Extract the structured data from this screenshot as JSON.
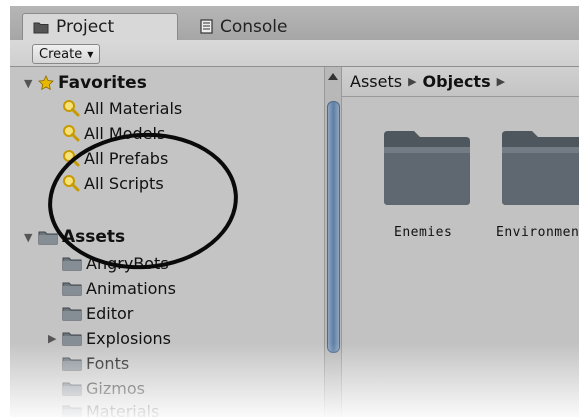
{
  "tabs": [
    {
      "label": "Project",
      "icon": "folder-tab-icon",
      "active": true
    },
    {
      "label": "Console",
      "icon": "console-tab-icon",
      "active": false
    }
  ],
  "toolbar": {
    "create_label": "Create"
  },
  "favorites": {
    "label": "Favorites",
    "items": [
      "All Materials",
      "All Models",
      "All Prefabs",
      "All Scripts"
    ]
  },
  "assets": {
    "label": "Assets",
    "items": [
      "AngryBots",
      "Animations",
      "Editor",
      "Explosions",
      "Fonts",
      "Gizmos",
      "Materials"
    ]
  },
  "breadcrumb": {
    "root": "Assets",
    "current": "Objects"
  },
  "grid": {
    "items": [
      "Enemies",
      "Environment"
    ]
  },
  "colors": {
    "folder": "#5f6870",
    "scroll_thumb": "#5f7ea3",
    "search_icon": "#e8b800"
  }
}
